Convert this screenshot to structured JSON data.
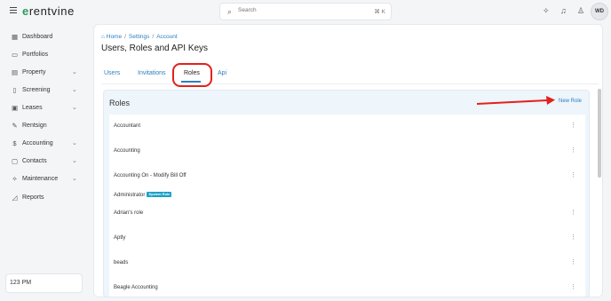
{
  "app": {
    "logo_prefix": "e",
    "logo_rest": "rentvine",
    "search_placeholder": "Search",
    "search_shortcut": "⌘ K",
    "avatar_initials": "WD"
  },
  "sidebar": {
    "items": [
      {
        "label": "Dashboard",
        "icon": "dashboard-icon",
        "glyph": "▦",
        "chevron": false
      },
      {
        "label": "Portfolios",
        "icon": "folder-icon",
        "glyph": "▭",
        "chevron": false
      },
      {
        "label": "Property",
        "icon": "building-icon",
        "glyph": "▤",
        "chevron": true
      },
      {
        "label": "Screening",
        "icon": "document-search-icon",
        "glyph": "▯",
        "chevron": true
      },
      {
        "label": "Leases",
        "icon": "lease-icon",
        "glyph": "▣",
        "chevron": true
      },
      {
        "label": "Rentsign",
        "icon": "signature-icon",
        "glyph": "✎",
        "chevron": false
      },
      {
        "label": "Accounting",
        "icon": "dollar-icon",
        "glyph": "$",
        "chevron": true
      },
      {
        "label": "Contacts",
        "icon": "contacts-icon",
        "glyph": "▢",
        "chevron": true
      },
      {
        "label": "Maintenance",
        "icon": "wrench-icon",
        "glyph": "✧",
        "chevron": true
      },
      {
        "label": "Reports",
        "icon": "chart-icon",
        "glyph": "◿",
        "chevron": false
      }
    ],
    "time": "123 PM"
  },
  "breadcrumb": {
    "home": "Home",
    "settings": "Settings",
    "account": "Account",
    "separator": "/"
  },
  "page": {
    "title": "Users, Roles and API Keys"
  },
  "tabs": [
    {
      "label": "Users",
      "active": false
    },
    {
      "label": "Invitations",
      "active": false
    },
    {
      "label": "Roles",
      "active": true
    },
    {
      "label": "Api",
      "active": false
    }
  ],
  "roles_card": {
    "title": "Roles",
    "new_role_label": "New Role",
    "rows": [
      {
        "name": "Accountant",
        "badge": "",
        "has_menu": true
      },
      {
        "name": "Accounting",
        "badge": "",
        "has_menu": true
      },
      {
        "name": "Accounting On - Modify Bill Off",
        "badge": "",
        "has_menu": true
      },
      {
        "name": "Administrator",
        "badge": "System Role",
        "has_menu": false
      },
      {
        "name": "Adrian's role",
        "badge": "",
        "has_menu": true
      },
      {
        "name": "Aptly",
        "badge": "",
        "has_menu": true
      },
      {
        "name": "beads",
        "badge": "",
        "has_menu": true
      },
      {
        "name": "Beagle Accounting",
        "badge": "",
        "has_menu": true
      }
    ]
  },
  "colors": {
    "accent": "#2d7fc1",
    "brand_green": "#2e9a59",
    "annotation_red": "#e2211c",
    "badge": "#1aa0c8"
  }
}
